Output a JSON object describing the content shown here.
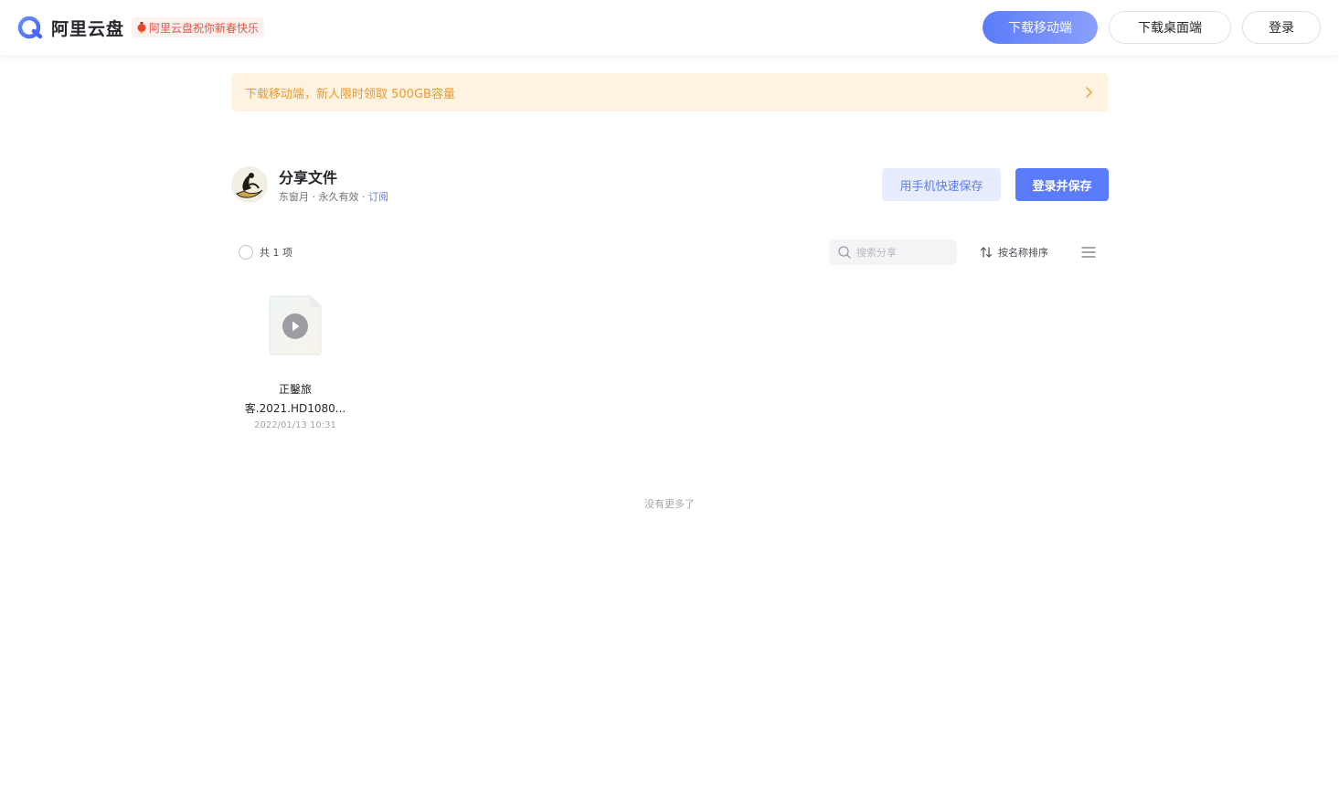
{
  "header": {
    "app_name": "阿里云盘",
    "promo_text": "阿里云盘祝你新春快乐",
    "download_mobile_label": "下载移动端",
    "download_desktop_label": "下载桌面端",
    "login_label": "登录"
  },
  "banner": {
    "text": "下载移动端，新人限时领取 500GB容量"
  },
  "share": {
    "title": "分享文件",
    "owner": "东窗月",
    "separator": " · ",
    "validity": "永久有效",
    "subscribe_label": "订阅",
    "phone_save_label": "用手机快速保存",
    "login_save_label": "登录并保存"
  },
  "toolbar": {
    "count_text": "共 1 项",
    "search_placeholder": "搜索分享",
    "sort_label": "按名称排序"
  },
  "files": [
    {
      "name_line1": "正鑿旅",
      "name_line2": "客.2021.HD1080...",
      "date": "2022/01/13 10:31",
      "type_icon": "video-file-icon"
    }
  ],
  "footer": {
    "no_more_text": "没有更多了"
  },
  "colors": {
    "primary": "#5b7cfa",
    "banner_bg": "#fef2e1",
    "banner_text": "#ee9a2c",
    "promo_text": "#e0554a"
  }
}
